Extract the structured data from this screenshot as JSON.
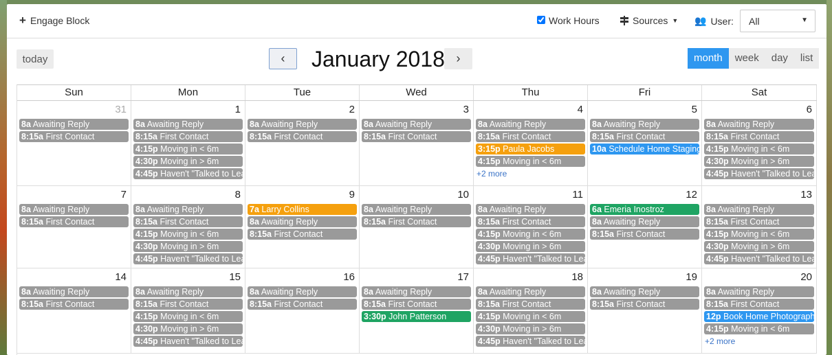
{
  "topbar": {
    "engage_label": "Engage Block",
    "workhours_label": "Work Hours",
    "workhours_checked": true,
    "sources_label": "Sources",
    "user_label": "User:",
    "user_selected": "All"
  },
  "toolbar": {
    "today_label": "today",
    "prev_label": "‹",
    "next_label": "›",
    "title": "January 2018",
    "views": [
      "month",
      "week",
      "day",
      "list"
    ],
    "active_view": "month"
  },
  "days_of_week": [
    "Sun",
    "Mon",
    "Tue",
    "Wed",
    "Thu",
    "Fri",
    "Sat"
  ],
  "colors": {
    "gray": "#9a9a9a",
    "orange": "#f5a00e",
    "blue": "#2e97f0",
    "green": "#1fa463"
  },
  "weeks": [
    [
      {
        "num": "31",
        "other": true,
        "events": [
          [
            "8a",
            "Awaiting Reply",
            "gray"
          ],
          [
            "8:15a",
            "First Contact",
            "gray"
          ]
        ]
      },
      {
        "num": "1",
        "events": [
          [
            "8a",
            "Awaiting Reply",
            "gray"
          ],
          [
            "8:15a",
            "First Contact",
            "gray"
          ],
          [
            "4:15p",
            "Moving in < 6m",
            "gray"
          ],
          [
            "4:30p",
            "Moving in > 6m",
            "gray"
          ],
          [
            "4:45p",
            "Haven't \"Talked to Lea",
            "gray"
          ]
        ]
      },
      {
        "num": "2",
        "events": [
          [
            "8a",
            "Awaiting Reply",
            "gray"
          ],
          [
            "8:15a",
            "First Contact",
            "gray"
          ]
        ]
      },
      {
        "num": "3",
        "events": [
          [
            "8a",
            "Awaiting Reply",
            "gray"
          ],
          [
            "8:15a",
            "First Contact",
            "gray"
          ]
        ]
      },
      {
        "num": "4",
        "events": [
          [
            "8a",
            "Awaiting Reply",
            "gray"
          ],
          [
            "8:15a",
            "First Contact",
            "gray"
          ],
          [
            "3:15p",
            "Paula Jacobs",
            "orange"
          ],
          [
            "4:15p",
            "Moving in < 6m",
            "gray"
          ]
        ],
        "more": "+2 more"
      },
      {
        "num": "5",
        "events": [
          [
            "8a",
            "Awaiting Reply",
            "gray"
          ],
          [
            "8:15a",
            "First Contact",
            "gray"
          ],
          [
            "10a",
            "Schedule Home Staging",
            "blue"
          ]
        ]
      },
      {
        "num": "6",
        "events": [
          [
            "8a",
            "Awaiting Reply",
            "gray"
          ],
          [
            "8:15a",
            "First Contact",
            "gray"
          ],
          [
            "4:15p",
            "Moving in < 6m",
            "gray"
          ],
          [
            "4:30p",
            "Moving in > 6m",
            "gray"
          ],
          [
            "4:45p",
            "Haven't \"Talked to Lea",
            "gray"
          ]
        ]
      }
    ],
    [
      {
        "num": "7",
        "events": [
          [
            "8a",
            "Awaiting Reply",
            "gray"
          ],
          [
            "8:15a",
            "First Contact",
            "gray"
          ]
        ]
      },
      {
        "num": "8",
        "events": [
          [
            "8a",
            "Awaiting Reply",
            "gray"
          ],
          [
            "8:15a",
            "First Contact",
            "gray"
          ],
          [
            "4:15p",
            "Moving in < 6m",
            "gray"
          ],
          [
            "4:30p",
            "Moving in > 6m",
            "gray"
          ],
          [
            "4:45p",
            "Haven't \"Talked to Lea",
            "gray"
          ]
        ]
      },
      {
        "num": "9",
        "events": [
          [
            "7a",
            "Larry Collins",
            "orange"
          ],
          [
            "8a",
            "Awaiting Reply",
            "gray"
          ],
          [
            "8:15a",
            "First Contact",
            "gray"
          ]
        ]
      },
      {
        "num": "10",
        "events": [
          [
            "8a",
            "Awaiting Reply",
            "gray"
          ],
          [
            "8:15a",
            "First Contact",
            "gray"
          ]
        ]
      },
      {
        "num": "11",
        "events": [
          [
            "8a",
            "Awaiting Reply",
            "gray"
          ],
          [
            "8:15a",
            "First Contact",
            "gray"
          ],
          [
            "4:15p",
            "Moving in < 6m",
            "gray"
          ],
          [
            "4:30p",
            "Moving in > 6m",
            "gray"
          ],
          [
            "4:45p",
            "Haven't \"Talked to Lea",
            "gray"
          ]
        ]
      },
      {
        "num": "12",
        "events": [
          [
            "6a",
            "Emeria Inostroz",
            "green"
          ],
          [
            "8a",
            "Awaiting Reply",
            "gray"
          ],
          [
            "8:15a",
            "First Contact",
            "gray"
          ]
        ]
      },
      {
        "num": "13",
        "events": [
          [
            "8a",
            "Awaiting Reply",
            "gray"
          ],
          [
            "8:15a",
            "First Contact",
            "gray"
          ],
          [
            "4:15p",
            "Moving in < 6m",
            "gray"
          ],
          [
            "4:30p",
            "Moving in > 6m",
            "gray"
          ],
          [
            "4:45p",
            "Haven't \"Talked to Lea",
            "gray"
          ]
        ]
      }
    ],
    [
      {
        "num": "14",
        "events": [
          [
            "8a",
            "Awaiting Reply",
            "gray"
          ],
          [
            "8:15a",
            "First Contact",
            "gray"
          ]
        ]
      },
      {
        "num": "15",
        "events": [
          [
            "8a",
            "Awaiting Reply",
            "gray"
          ],
          [
            "8:15a",
            "First Contact",
            "gray"
          ],
          [
            "4:15p",
            "Moving in < 6m",
            "gray"
          ],
          [
            "4:30p",
            "Moving in > 6m",
            "gray"
          ],
          [
            "4:45p",
            "Haven't \"Talked to Lea",
            "gray"
          ]
        ]
      },
      {
        "num": "16",
        "events": [
          [
            "8a",
            "Awaiting Reply",
            "gray"
          ],
          [
            "8:15a",
            "First Contact",
            "gray"
          ]
        ]
      },
      {
        "num": "17",
        "events": [
          [
            "8a",
            "Awaiting Reply",
            "gray"
          ],
          [
            "8:15a",
            "First Contact",
            "gray"
          ],
          [
            "3:30p",
            "John Patterson",
            "green"
          ]
        ]
      },
      {
        "num": "18",
        "events": [
          [
            "8a",
            "Awaiting Reply",
            "gray"
          ],
          [
            "8:15a",
            "First Contact",
            "gray"
          ],
          [
            "4:15p",
            "Moving in < 6m",
            "gray"
          ],
          [
            "4:30p",
            "Moving in > 6m",
            "gray"
          ],
          [
            "4:45p",
            "Haven't \"Talked to Lea",
            "gray"
          ]
        ]
      },
      {
        "num": "19",
        "events": [
          [
            "8a",
            "Awaiting Reply",
            "gray"
          ],
          [
            "8:15a",
            "First Contact",
            "gray"
          ]
        ]
      },
      {
        "num": "20",
        "events": [
          [
            "8a",
            "Awaiting Reply",
            "gray"
          ],
          [
            "8:15a",
            "First Contact",
            "gray"
          ],
          [
            "12p",
            "Book Home Photograph",
            "blue"
          ],
          [
            "4:15p",
            "Moving in < 6m",
            "gray"
          ]
        ],
        "more": "+2 more"
      }
    ]
  ]
}
